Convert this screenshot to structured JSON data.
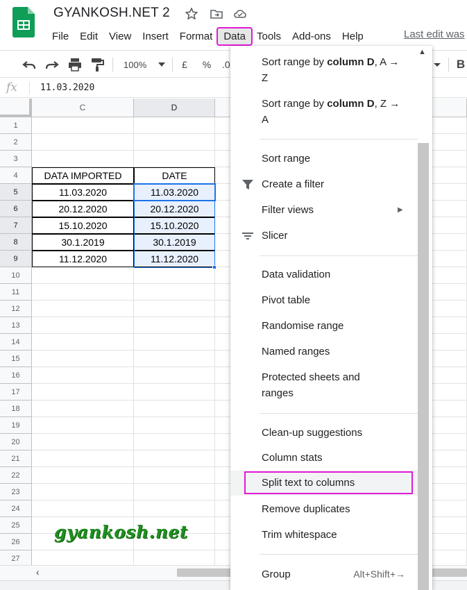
{
  "app": {
    "title": "GYANKOSH.NET 2",
    "last_edit": "Last edit was",
    "icons": [
      "star-icon",
      "move-to-folder-icon",
      "cloud-status-icon"
    ]
  },
  "menubar": [
    "File",
    "Edit",
    "View",
    "Insert",
    "Format",
    "Data",
    "Tools",
    "Add-ons",
    "Help"
  ],
  "toolbar": {
    "zoom": "100%",
    "currency": "£",
    "percent": "%",
    "decimal": ".0",
    "bold": "B"
  },
  "formula_bar": {
    "fx": "fx",
    "value": "11.03.2020"
  },
  "grid": {
    "columns": [
      "C",
      "D"
    ],
    "rows": [
      "1",
      "2",
      "3",
      "4",
      "5",
      "6",
      "7",
      "8",
      "9",
      "10",
      "11",
      "12",
      "13",
      "14",
      "15",
      "16",
      "17",
      "18",
      "19",
      "20",
      "21",
      "22",
      "23",
      "24",
      "25",
      "26",
      "27"
    ],
    "headers": {
      "c": "DATA IMPORTED",
      "d": "DATE"
    },
    "data": [
      {
        "c": "11.03.2020",
        "d": "11.03.2020"
      },
      {
        "c": "20.12.2020",
        "d": "20.12.2020"
      },
      {
        "c": "15.10.2020",
        "d": "15.10.2020"
      },
      {
        "c": "30.1.2019",
        "d": "30.1.2019"
      },
      {
        "c": "11.12.2020",
        "d": "11.12.2020"
      }
    ]
  },
  "scroll": {
    "left_arrow": "‹"
  },
  "watermark": "gyankosh.net",
  "data_menu": {
    "sort_az": {
      "pre": "Sort range by ",
      "bold": "column D",
      "post": ", A → Z"
    },
    "sort_za": {
      "pre": "Sort range by ",
      "bold": "column D",
      "post": ", Z → A"
    },
    "sort_range": "Sort range",
    "create_filter": "Create a filter",
    "filter_views": "Filter views",
    "slicer": "Slicer",
    "data_validation": "Data validation",
    "pivot_table": "Pivot table",
    "randomise_range": "Randomise range",
    "named_ranges": "Named ranges",
    "protected_sheets": "Protected sheets and ranges",
    "cleanup": "Clean-up suggestions",
    "column_stats": "Column stats",
    "split_text": "Split text to columns",
    "remove_duplicates": "Remove duplicates",
    "trim_whitespace": "Trim whitespace",
    "group": "Group",
    "group_shortcut": "Alt+Shift+→",
    "submenu_arrow": "▶",
    "scroll_up": "▲"
  },
  "colors": {
    "highlight": "#e11ad6",
    "selection": "#1a73e8",
    "selection_fill": "#e8f0fe",
    "watermark": "#1f8f1f",
    "sheets_green": "#0f9d58"
  }
}
